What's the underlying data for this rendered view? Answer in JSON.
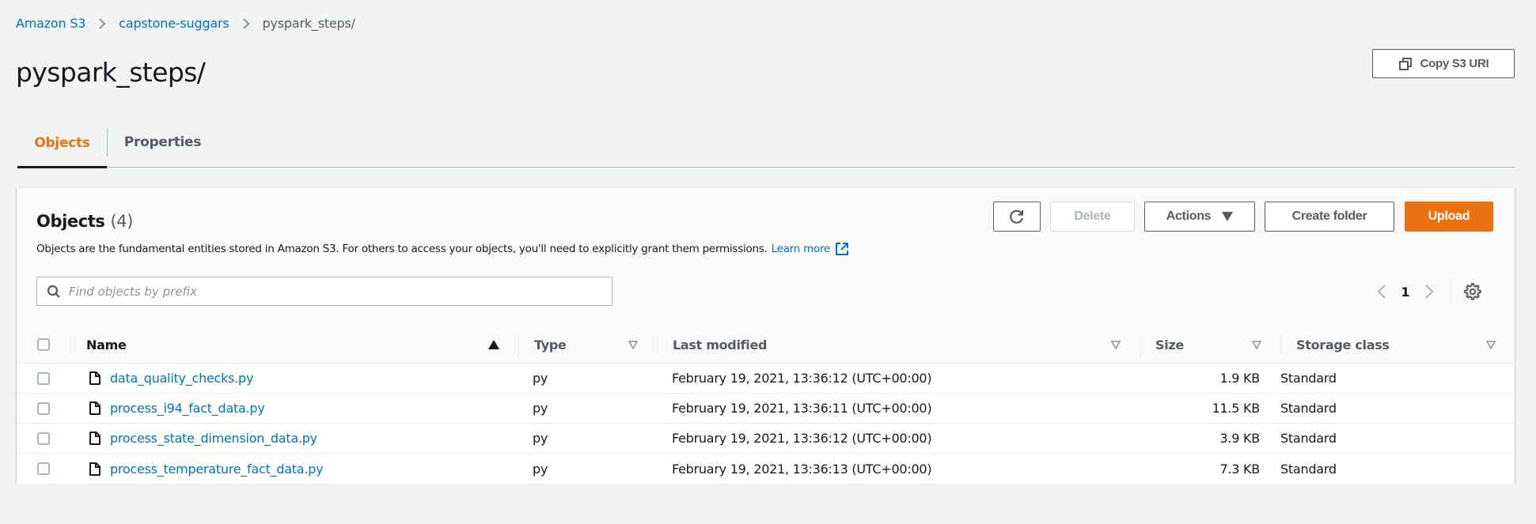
{
  "breadcrumb": {
    "items": [
      {
        "label": "Amazon S3"
      },
      {
        "label": "capstone-suggars"
      }
    ],
    "current": "pyspark_steps/"
  },
  "page": {
    "title": "pyspark_steps/",
    "copy_uri_label": "Copy S3 URI"
  },
  "tabs": [
    {
      "label": "Objects",
      "active": true
    },
    {
      "label": "Properties",
      "active": false
    }
  ],
  "objects_panel": {
    "title": "Objects",
    "count": "(4)",
    "description": "Objects are the fundamental entities stored in Amazon S3. For others to access your objects, you'll need to explicitly grant them permissions.",
    "learn_more": "Learn more",
    "toolbar": {
      "refresh_icon": "refresh-icon",
      "delete_label": "Delete",
      "actions_label": "Actions",
      "create_folder_label": "Create folder",
      "upload_label": "Upload"
    },
    "search": {
      "placeholder": "Find objects by prefix",
      "value": ""
    },
    "pagination": {
      "current_page": "1"
    }
  },
  "table": {
    "columns": [
      {
        "label": "Name",
        "sort": "ascending"
      },
      {
        "label": "Type",
        "sort": "none"
      },
      {
        "label": "Last modified",
        "sort": "none"
      },
      {
        "label": "Size",
        "sort": "none"
      },
      {
        "label": "Storage class",
        "sort": "none"
      }
    ],
    "rows": [
      {
        "name": "data_quality_checks.py",
        "type": "py",
        "last_modified": "February 19, 2021, 13:36:12 (UTC+00:00)",
        "size": "1.9 KB",
        "storage_class": "Standard"
      },
      {
        "name": "process_i94_fact_data.py",
        "type": "py",
        "last_modified": "February 19, 2021, 13:36:11 (UTC+00:00)",
        "size": "11.5 KB",
        "storage_class": "Standard"
      },
      {
        "name": "process_state_dimension_data.py",
        "type": "py",
        "last_modified": "February 19, 2021, 13:36:12 (UTC+00:00)",
        "size": "3.9 KB",
        "storage_class": "Standard"
      },
      {
        "name": "process_temperature_fact_data.py",
        "type": "py",
        "last_modified": "February 19, 2021, 13:36:13 (UTC+00:00)",
        "size": "7.3 KB",
        "storage_class": "Standard"
      }
    ]
  },
  "colors": {
    "accent": "#ec7211",
    "link": "#0073bb",
    "text": "#16191f",
    "muted": "#545b64",
    "background": "#f2f3f3"
  }
}
